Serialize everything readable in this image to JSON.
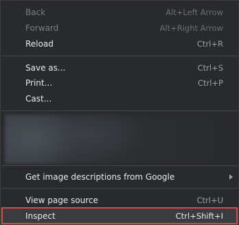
{
  "menu": {
    "back": {
      "label": "Back",
      "shortcut": "Alt+Left Arrow"
    },
    "forward": {
      "label": "Forward",
      "shortcut": "Alt+Right Arrow"
    },
    "reload": {
      "label": "Reload",
      "shortcut": "Ctrl+R"
    },
    "save_as": {
      "label": "Save as...",
      "shortcut": "Ctrl+S"
    },
    "print": {
      "label": "Print...",
      "shortcut": "Ctrl+P"
    },
    "cast": {
      "label": "Cast...",
      "shortcut": ""
    },
    "image_descriptions": {
      "label": "Get image descriptions from Google",
      "icon": "chevron-right-icon"
    },
    "view_source": {
      "label": "View page source",
      "shortcut": "Ctrl+U"
    },
    "inspect": {
      "label": "Inspect",
      "shortcut": "Ctrl+Shift+I"
    }
  },
  "colors": {
    "background": "#292a2d",
    "text": "#e8eaed",
    "disabled_text": "#7c7e82",
    "highlight_border": "#d8484f"
  }
}
